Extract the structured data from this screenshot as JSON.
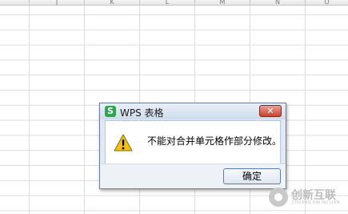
{
  "sheet": {
    "columns": [
      "J",
      "K",
      "L",
      "M",
      "N",
      "O"
    ]
  },
  "dialog": {
    "title": "WPS 表格",
    "app_icon_glyph": "S",
    "message": "不能对合并单元格作部分修改。",
    "ok_label": "确定",
    "close_glyph": "✕",
    "icon": "warning-icon"
  },
  "watermark": {
    "text": "创新互联",
    "subtext": "CHUANG XIN HU LIAN"
  }
}
